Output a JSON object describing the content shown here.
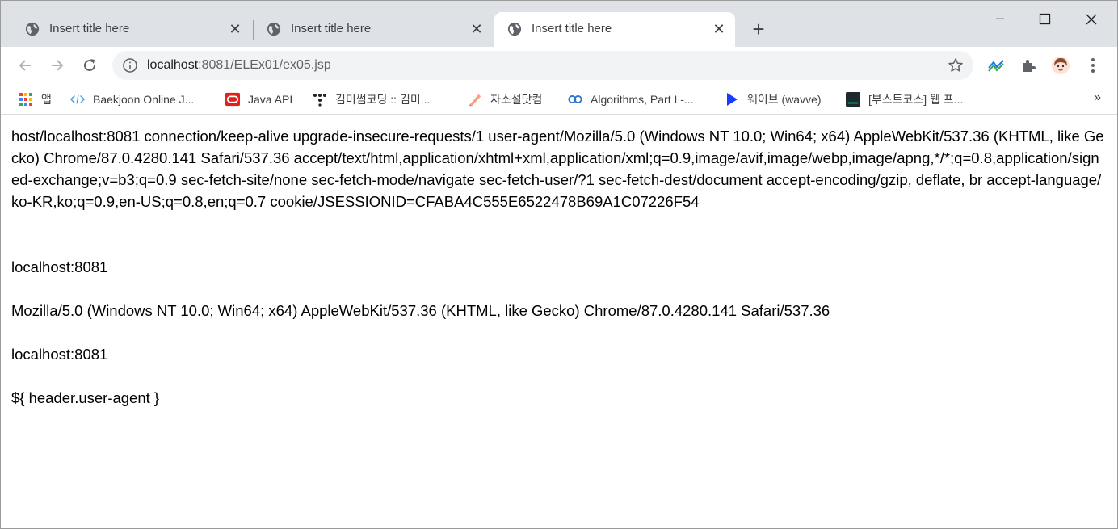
{
  "browser": {
    "tabs": [
      {
        "title": "Insert title here",
        "active": false
      },
      {
        "title": "Insert title here",
        "active": false
      },
      {
        "title": "Insert title here",
        "active": true
      }
    ],
    "new_tab_label": "+",
    "window_controls": {
      "minimize": "–",
      "maximize": "☐",
      "close": "✕"
    },
    "address": {
      "host": "localhost",
      "rest": ":8081/ELEx01/ex05.jsp"
    },
    "bookmarks": [
      {
        "label": "앱",
        "icon": "apps-grid-icon"
      },
      {
        "label": "Baekjoon Online J...",
        "icon": "code-icon"
      },
      {
        "label": "Java API",
        "icon": "oracle-icon"
      },
      {
        "label": "김미썸코딩 :: 김미...",
        "icon": "dots-icon"
      },
      {
        "label": "자소설닷컴",
        "icon": "pen-icon"
      },
      {
        "label": "Algorithms, Part I -...",
        "icon": "coursera-icon"
      },
      {
        "label": "웨이브 (wavve)",
        "icon": "play-icon"
      },
      {
        "label": "[부스트코스] 웹 프...",
        "icon": "terminal-icon"
      }
    ],
    "bookmarks_more": "»",
    "accent_colors": {
      "tabstrip": "#dee1e6",
      "omnibox": "#f1f3f4"
    }
  },
  "page": {
    "headers_dump": "host/localhost:8081 connection/keep-alive upgrade-insecure-requests/1 user-agent/Mozilla/5.0 (Windows NT 10.0; Win64; x64) AppleWebKit/537.36 (KHTML, like Gecko) Chrome/87.0.4280.141 Safari/537.36 accept/text/html,application/xhtml+xml,application/xml;q=0.9,image/avif,image/webp,image/apng,*/*;q=0.8,application/signed-exchange;v=b3;q=0.9 sec-fetch-site/none sec-fetch-mode/navigate sec-fetch-user/?1 sec-fetch-dest/document accept-encoding/gzip, deflate, br accept-language/ko-KR,ko;q=0.9,en-US;q=0.8,en;q=0.7 cookie/JSESSIONID=CFABA4C555E6522478B69A1C07226F54",
    "host_1": "localhost:8081",
    "user_agent": "Mozilla/5.0 (Windows NT 10.0; Win64; x64) AppleWebKit/537.36 (KHTML, like Gecko) Chrome/87.0.4280.141 Safari/537.36",
    "host_2": "localhost:8081",
    "el_literal": "${ header.user-agent }"
  }
}
